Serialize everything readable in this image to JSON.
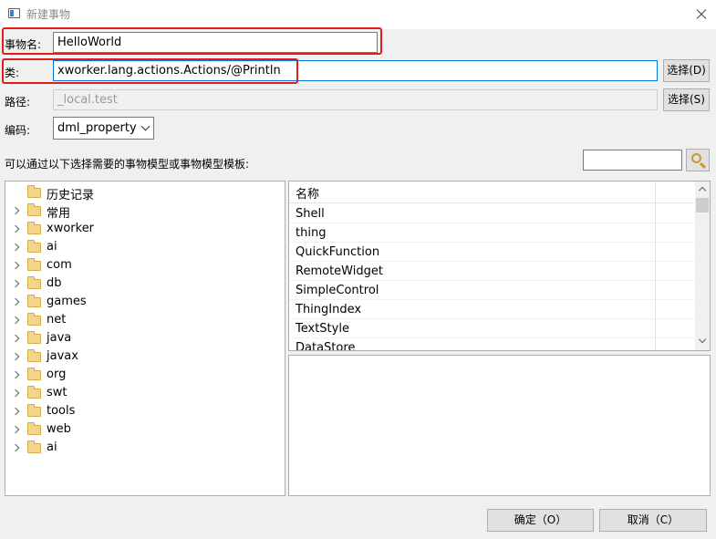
{
  "window": {
    "title": "新建事物"
  },
  "form": {
    "name_label": "事物名:",
    "name_value": "HelloWorld",
    "class_label": "类:",
    "class_value": "xworker.lang.actions.Actions/@Println",
    "class_button": "选择(D)",
    "path_label": "路径:",
    "path_value": "_local.test",
    "path_button": "选择(S)",
    "encoding_label": "编码:",
    "encoding_value": "dml_property"
  },
  "hint": {
    "text": "可以通过以下选择需要的事物模型或事物模型模板:"
  },
  "search": {
    "value": ""
  },
  "tree": {
    "items": [
      {
        "label": "历史记录",
        "expandable": false
      },
      {
        "label": "常用",
        "expandable": true
      },
      {
        "label": "xworker",
        "expandable": true
      },
      {
        "label": "ai",
        "expandable": true
      },
      {
        "label": "com",
        "expandable": true
      },
      {
        "label": "db",
        "expandable": true
      },
      {
        "label": "games",
        "expandable": true
      },
      {
        "label": "net",
        "expandable": true
      },
      {
        "label": "java",
        "expandable": true
      },
      {
        "label": "javax",
        "expandable": true
      },
      {
        "label": "org",
        "expandable": true
      },
      {
        "label": "swt",
        "expandable": true
      },
      {
        "label": "tools",
        "expandable": true
      },
      {
        "label": "web",
        "expandable": true
      },
      {
        "label": "ai",
        "expandable": true
      }
    ]
  },
  "list": {
    "header": "名称",
    "rows": [
      "Shell",
      "thing",
      "QuickFunction",
      "RemoteWidget",
      "SimpleControl",
      "ThingIndex",
      "TextStyle",
      "DataStore"
    ]
  },
  "buttons": {
    "ok": "确定（O）",
    "cancel": "取消（C）"
  },
  "colors": {
    "highlight": "#e11c1c",
    "focus_border": "#0078d7"
  }
}
